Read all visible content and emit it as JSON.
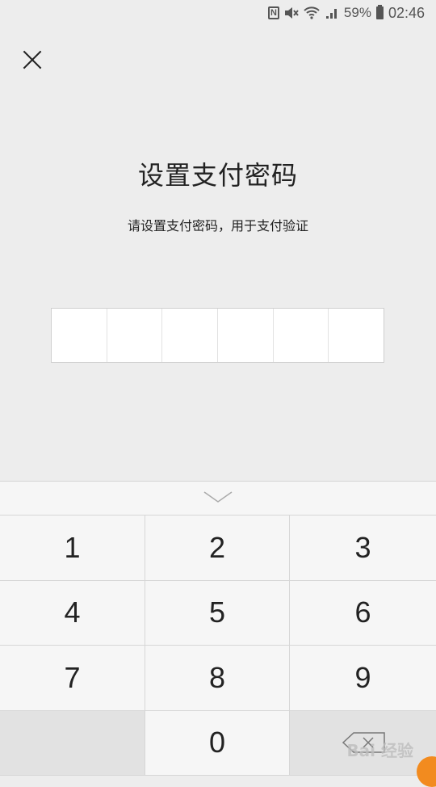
{
  "status_bar": {
    "nfc_icon": "N",
    "battery_percent": "59%",
    "time": "02:46",
    "icons": [
      "nfc-icon",
      "mute-icon",
      "wifi-icon",
      "4g-signal-icon",
      "battery-icon"
    ]
  },
  "header": {
    "title": "设置支付密码",
    "subtitle": "请设置支付密码，用于支付验证"
  },
  "pin": {
    "length": 6,
    "filled": 0
  },
  "keypad": {
    "keys": [
      "1",
      "2",
      "3",
      "4",
      "5",
      "6",
      "7",
      "8",
      "9",
      "",
      "0",
      ""
    ],
    "collapse_icon": "chevron-down-icon",
    "delete_icon": "backspace-icon"
  },
  "watermark": "Bai 经验"
}
